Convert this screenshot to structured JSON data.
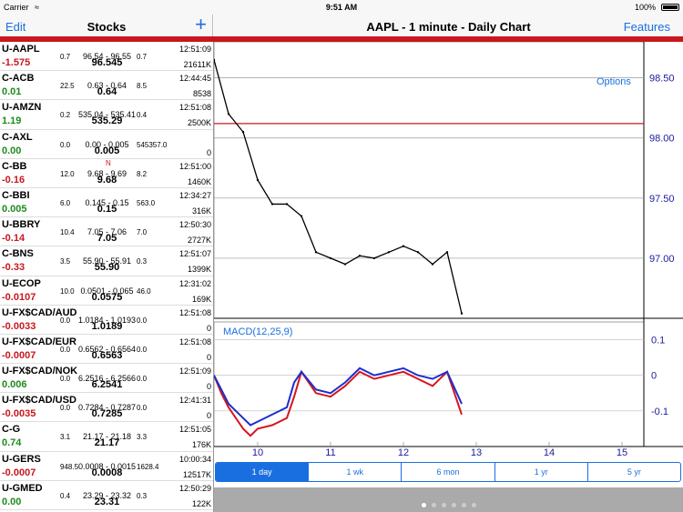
{
  "status": {
    "carrier": "Carrier",
    "time": "9:51 AM",
    "battery": "100%"
  },
  "left_nav": {
    "edit": "Edit",
    "title": "Stocks",
    "plus": "+"
  },
  "right_nav": {
    "title": "AAPL - 1 minute - Daily Chart",
    "features": "Features"
  },
  "stocks": [
    {
      "symbol": "U-AAPL",
      "time": "12:51:09",
      "change": "-1.575",
      "dir": "neg",
      "last": "96.545",
      "volume": "21611K",
      "bid_size": "0.7",
      "range": "96.54 - 96.55",
      "ask_size": "0.7",
      "news": ""
    },
    {
      "symbol": "C-ACB",
      "time": "12:44:45",
      "change": "0.01",
      "dir": "pos",
      "last": "0.64",
      "volume": "8538",
      "bid_size": "22.5",
      "range": "0.63 - 0.64",
      "ask_size": "8.5",
      "news": ""
    },
    {
      "symbol": "U-AMZN",
      "time": "12:51:08",
      "change": "1.19",
      "dir": "pos",
      "last": "535.29",
      "volume": "2500K",
      "bid_size": "0.2",
      "range": "535.04 - 535.41",
      "ask_size": "0.4",
      "news": ""
    },
    {
      "symbol": "C-AXL",
      "time": "",
      "change": "0.00",
      "dir": "pos",
      "last": "0.005",
      "volume": "0",
      "bid_size": "0.0",
      "range": "0.00 - 0.005",
      "ask_size": "545357.0",
      "news": ""
    },
    {
      "symbol": "C-BB",
      "time": "12:51:00",
      "change": "-0.16",
      "dir": "neg",
      "last": "9.68",
      "volume": "1460K",
      "bid_size": "12.0",
      "range": "9.68 - 9.69",
      "ask_size": "8.2",
      "news": "N"
    },
    {
      "symbol": "C-BBI",
      "time": "12:34:27",
      "change": "0.005",
      "dir": "pos",
      "last": "0.15",
      "volume": "316K",
      "bid_size": "6.0",
      "range": "0.145 - 0.15",
      "ask_size": "563.0",
      "news": ""
    },
    {
      "symbol": "U-BBRY",
      "time": "12:50:30",
      "change": "-0.14",
      "dir": "neg",
      "last": "7.05",
      "volume": "2727K",
      "bid_size": "10.4",
      "range": "7.05 - 7.06",
      "ask_size": "7.0",
      "news": ""
    },
    {
      "symbol": "C-BNS",
      "time": "12:51:07",
      "change": "-0.33",
      "dir": "neg",
      "last": "55.90",
      "volume": "1399K",
      "bid_size": "3.5",
      "range": "55.90 - 55.91",
      "ask_size": "0.3",
      "news": ""
    },
    {
      "symbol": "U-ECOP",
      "time": "12:31:02",
      "change": "-0.0107",
      "dir": "neg",
      "last": "0.0575",
      "volume": "169K",
      "bid_size": "10.0",
      "range": "0.0501 - 0.065",
      "ask_size": "46.0",
      "news": ""
    },
    {
      "symbol": "U-FX$CAD/AUD",
      "time": "12:51:08",
      "change": "-0.0033",
      "dir": "neg",
      "last": "1.0189",
      "volume": "0",
      "bid_size": "0.0",
      "range": "1.0184 - 1.0193",
      "ask_size": "0.0",
      "news": ""
    },
    {
      "symbol": "U-FX$CAD/EUR",
      "time": "12:51:08",
      "change": "-0.0007",
      "dir": "neg",
      "last": "0.6563",
      "volume": "0",
      "bid_size": "0.0",
      "range": "0.6562 - 0.6564",
      "ask_size": "0.0",
      "news": ""
    },
    {
      "symbol": "U-FX$CAD/NOK",
      "time": "12:51:09",
      "change": "0.006",
      "dir": "pos",
      "last": "6.2541",
      "volume": "0",
      "bid_size": "0.0",
      "range": "6.2516 - 6.2566",
      "ask_size": "0.0",
      "news": ""
    },
    {
      "symbol": "U-FX$CAD/USD",
      "time": "12:41:31",
      "change": "-0.0035",
      "dir": "neg",
      "last": "0.7285",
      "volume": "0",
      "bid_size": "0.0",
      "range": "0.7284 - 0.7287",
      "ask_size": "0.0",
      "news": ""
    },
    {
      "symbol": "C-G",
      "time": "12:51:05",
      "change": "0.74",
      "dir": "pos",
      "last": "21.17",
      "volume": "176K",
      "bid_size": "3.1",
      "range": "21.17 - 21.18",
      "ask_size": "3.3",
      "news": ""
    },
    {
      "symbol": "U-GERS",
      "time": "10:00:34",
      "change": "-0.0007",
      "dir": "neg",
      "last": "0.0008",
      "volume": "12517K",
      "bid_size": "948.5",
      "range": "0.0008 - 0.0015",
      "ask_size": "1628.4",
      "news": ""
    },
    {
      "symbol": "U-GMED",
      "time": "12:50:29",
      "change": "0.00",
      "dir": "pos",
      "last": "23.31",
      "volume": "122K",
      "bid_size": "0.4",
      "range": "23.29 - 23.32",
      "ask_size": "0.3",
      "news": ""
    }
  ],
  "chart": {
    "options_label": "Options",
    "price_ticks": [
      "98.50",
      "98.00",
      "97.50",
      "97.00"
    ],
    "macd_label": "MACD(12,25,9)",
    "macd_ticks": [
      "0.1",
      "0",
      "-0.1"
    ],
    "x_ticks": [
      "10",
      "11",
      "12",
      "13",
      "14",
      "15"
    ],
    "reference_price": 98.12,
    "colors": {
      "price": "#000000",
      "macd": "#1a2fcf",
      "signal": "#d8141e",
      "reference": "#c8181e"
    }
  },
  "chart_data": {
    "type": "line",
    "title": "AAPL - 1 minute - Daily Chart",
    "xlabel": "",
    "ylabel": "",
    "x": [
      9.4,
      9.6,
      9.8,
      10.0,
      10.2,
      10.4,
      10.6,
      10.8,
      11.0,
      11.2,
      11.4,
      11.6,
      11.8,
      12.0,
      12.2,
      12.4,
      12.6,
      12.8
    ],
    "series": [
      {
        "name": "",
        "values": [
          98.65,
          98.2,
          98.05,
          97.65,
          97.45,
          97.45,
          97.35,
          97.05,
          97.0,
          96.95,
          97.02,
          97.0,
          97.05,
          97.1,
          97.05,
          96.95,
          97.05,
          96.54
        ]
      }
    ],
    "macd": {
      "name": "MACD(12,25,9)",
      "x": [
        9.4,
        9.5,
        9.6,
        9.8,
        9.9,
        10.0,
        10.2,
        10.4,
        10.5,
        10.6,
        10.8,
        11.0,
        11.2,
        11.4,
        11.6,
        11.8,
        12.0,
        12.2,
        12.4,
        12.6,
        12.8
      ],
      "macd": [
        0.0,
        -0.04,
        -0.08,
        -0.12,
        -0.14,
        -0.13,
        -0.11,
        -0.09,
        -0.02,
        0.01,
        -0.04,
        -0.05,
        -0.02,
        0.02,
        0.0,
        0.01,
        0.02,
        0.0,
        -0.01,
        0.01,
        -0.08
      ],
      "signal": [
        0.0,
        -0.05,
        -0.09,
        -0.15,
        -0.17,
        -0.15,
        -0.14,
        -0.12,
        -0.06,
        0.01,
        -0.05,
        -0.06,
        -0.03,
        0.01,
        -0.01,
        0.0,
        0.01,
        -0.01,
        -0.03,
        0.01,
        -0.11
      ]
    },
    "ylim": [
      96.5,
      98.8
    ],
    "macd_ylim": [
      -0.2,
      0.15
    ],
    "xlim": [
      9.4,
      15.3
    ],
    "grid": true
  },
  "ranges": [
    {
      "label": "1 day",
      "active": true
    },
    {
      "label": "1 wk",
      "active": false
    },
    {
      "label": "6 mon",
      "active": false
    },
    {
      "label": "1 yr",
      "active": false
    },
    {
      "label": "5 yr",
      "active": false
    }
  ],
  "pager": {
    "count": 6,
    "active": 0
  }
}
